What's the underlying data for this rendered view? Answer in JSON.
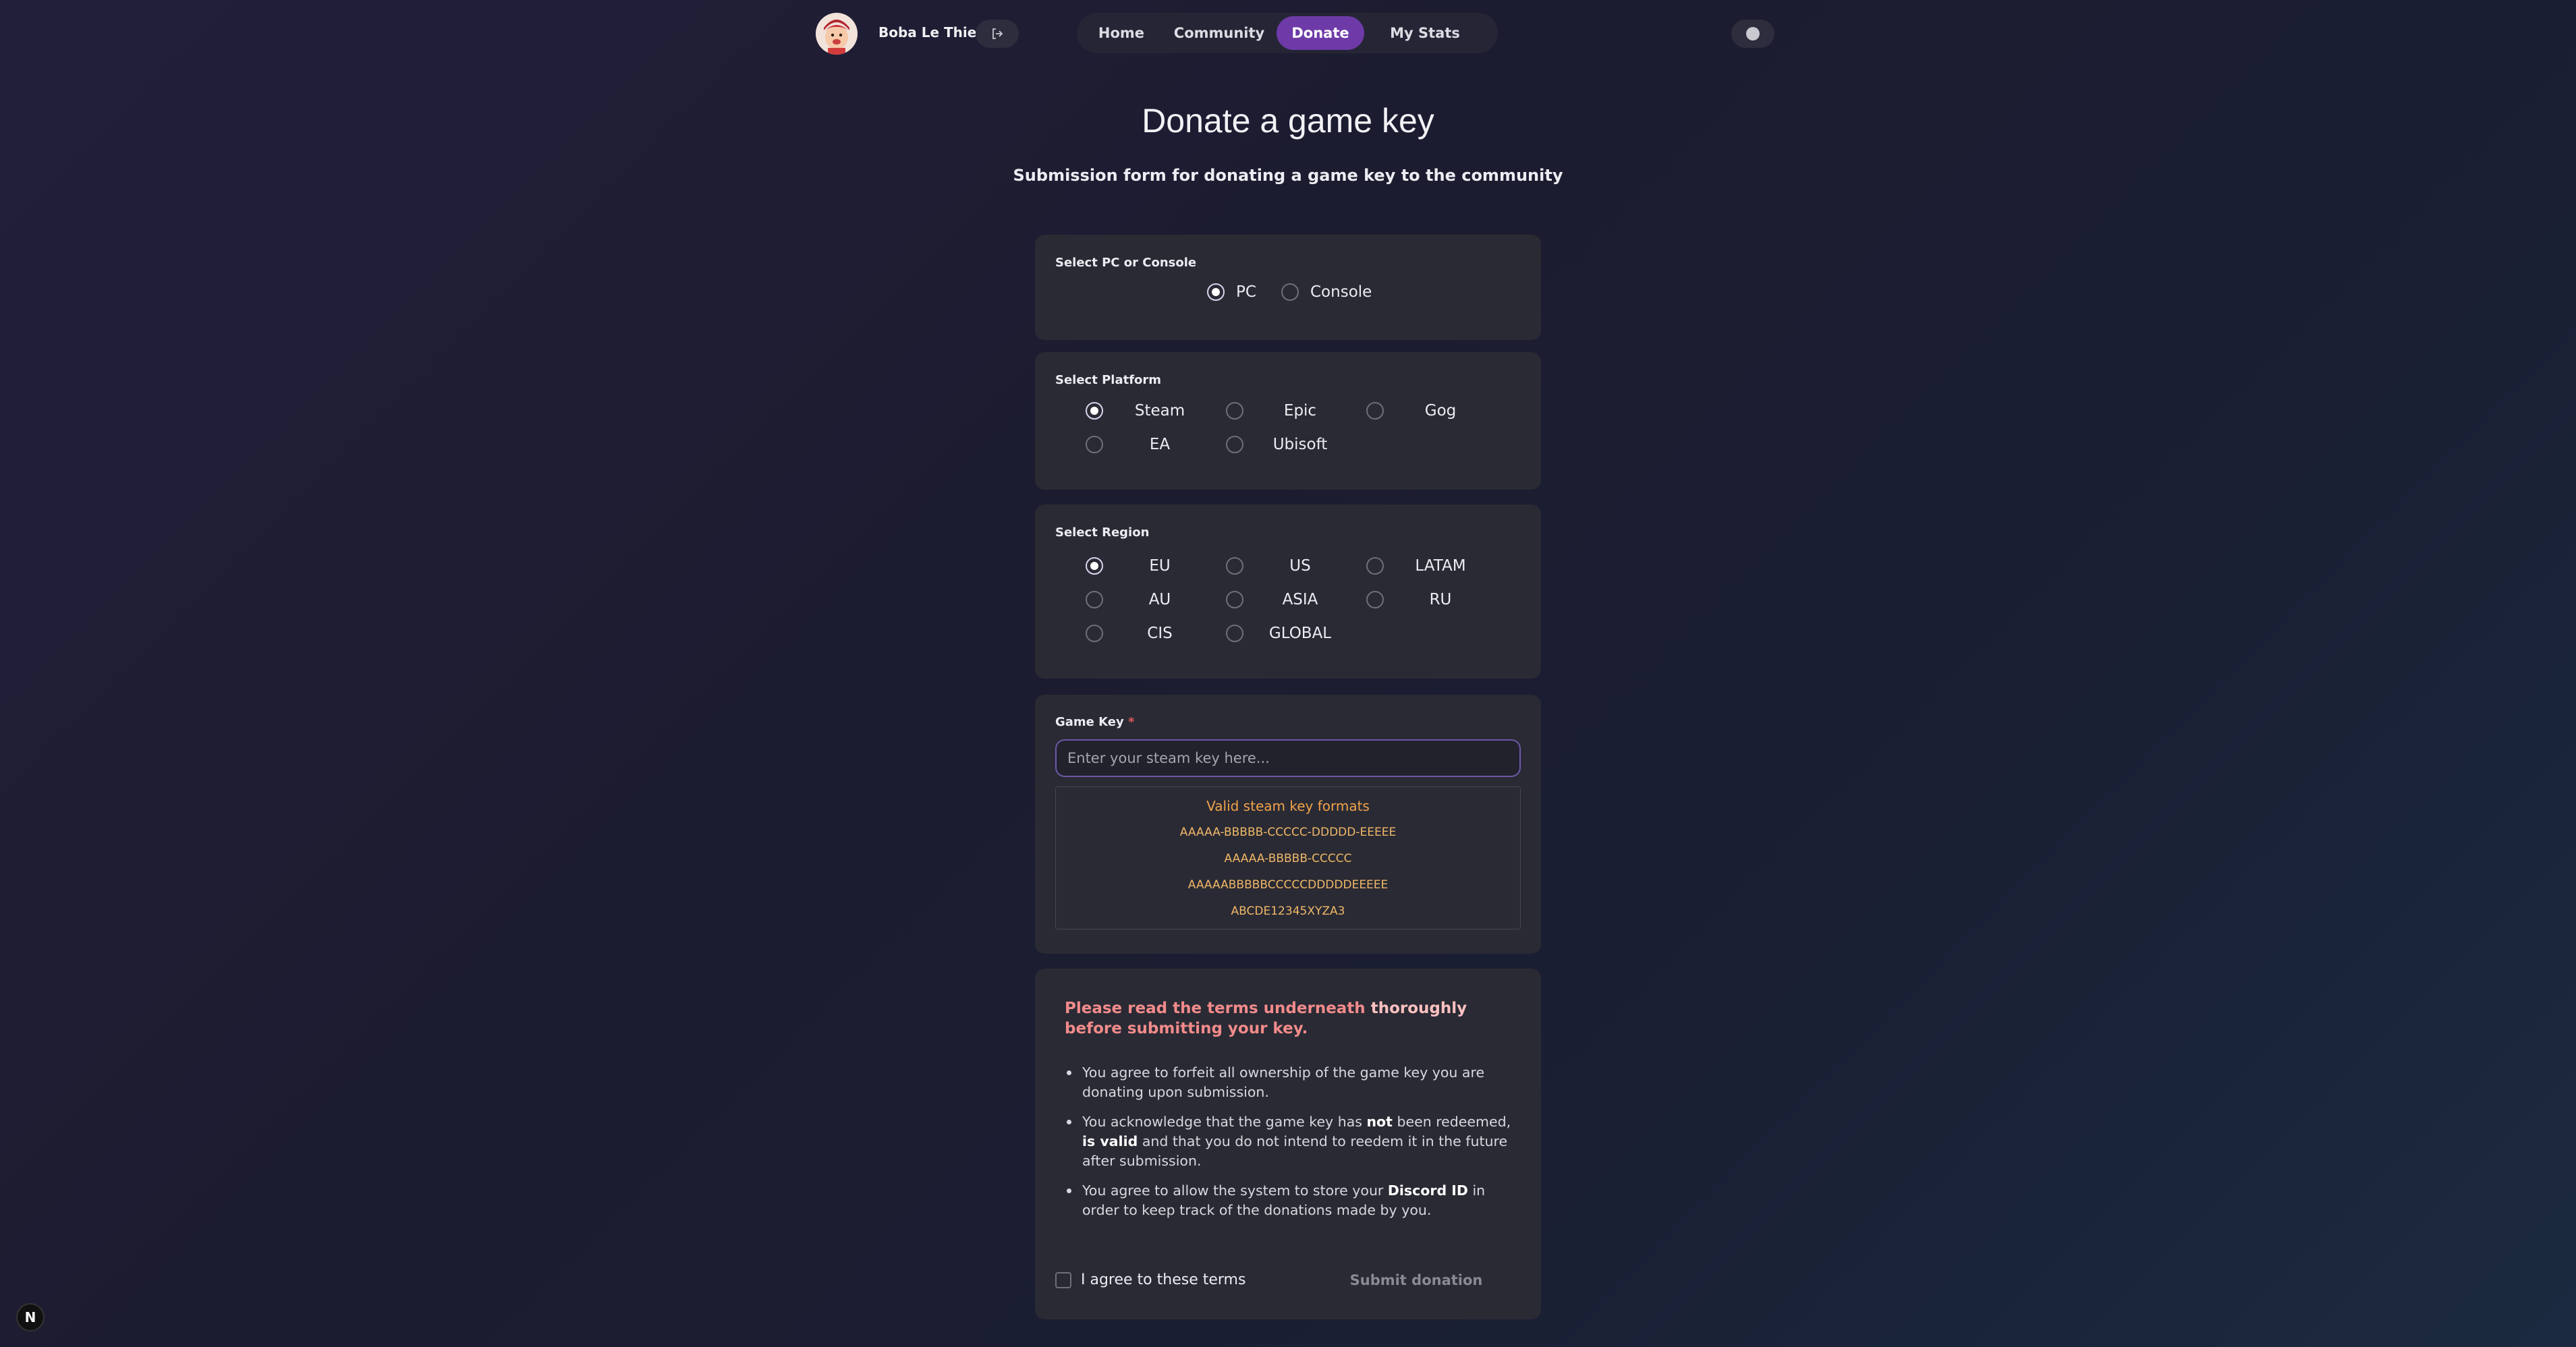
{
  "header": {
    "user_name": "Boba Le Thief",
    "nav": [
      {
        "label": "Home",
        "active": false
      },
      {
        "label": "Community",
        "active": false
      },
      {
        "label": "Donate",
        "active": true
      },
      {
        "label": "My Stats",
        "active": false
      }
    ]
  },
  "page": {
    "title": "Donate a game key",
    "subtitle": "Submission form for donating a game key to the community"
  },
  "device": {
    "label": "Select PC or Console",
    "options": [
      {
        "label": "PC",
        "checked": true
      },
      {
        "label": "Console",
        "checked": false
      }
    ]
  },
  "platform": {
    "label": "Select Platform",
    "options": [
      {
        "label": "Steam",
        "checked": true
      },
      {
        "label": "Epic",
        "checked": false
      },
      {
        "label": "Gog",
        "checked": false
      },
      {
        "label": "EA",
        "checked": false
      },
      {
        "label": "Ubisoft",
        "checked": false
      }
    ]
  },
  "region": {
    "label": "Select Region",
    "options": [
      {
        "label": "EU",
        "checked": true
      },
      {
        "label": "US",
        "checked": false
      },
      {
        "label": "LATAM",
        "checked": false
      },
      {
        "label": "AU",
        "checked": false
      },
      {
        "label": "ASIA",
        "checked": false
      },
      {
        "label": "RU",
        "checked": false
      },
      {
        "label": "CIS",
        "checked": false
      },
      {
        "label": "GLOBAL",
        "checked": false
      }
    ]
  },
  "game_key": {
    "label": "Game Key",
    "required_mark": "*",
    "value": "",
    "placeholder": "Enter your steam key here...",
    "formats_title": "Valid steam key formats",
    "formats": [
      "AAAAA-BBBBB-CCCCC-DDDDD-EEEEE",
      "AAAAA-BBBBB-CCCCC",
      "AAAAABBBBBCCCCCDDDDDEEEEE",
      "ABCDE12345XYZA3"
    ]
  },
  "terms": {
    "heading_pre": "Please read the terms underneath ",
    "heading_strong": "thoroughly",
    "heading_post": " before submitting your key.",
    "items": [
      {
        "parts": [
          "You agree to forfeit all ownership of the game key you are donating upon submission."
        ]
      },
      {
        "t1": "You acknowledge that the game key has ",
        "b1": "not",
        "t2": " been redeemed, ",
        "b2": "is valid",
        "t3": " and that you do not intend to reedem it in the future after submission."
      },
      {
        "t1": "You agree to allow the system to store your ",
        "b1": "Discord ID",
        "t2": " in order to keep track of the donations made by you."
      }
    ],
    "agree_label": "I agree to these terms",
    "agree_checked": false,
    "submit_label": "Submit donation"
  },
  "badge": {
    "label": "N"
  },
  "colors": {
    "accent": "#6e3aa8",
    "warning": "#f0a34a",
    "terms_heading": "#f28b8b"
  }
}
